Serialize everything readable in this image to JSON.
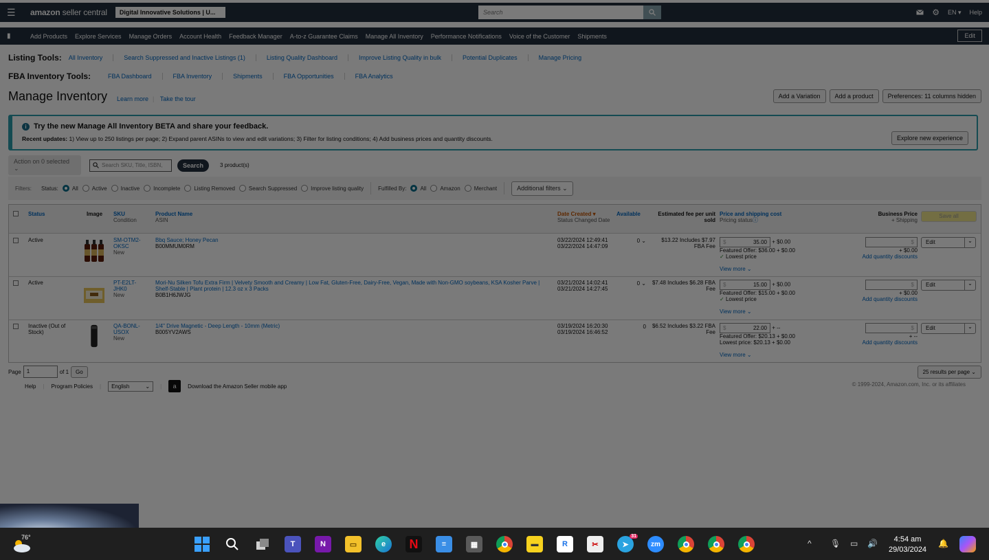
{
  "topbar": {
    "logo_bold": "amazon",
    "logo_rest": " seller central",
    "store": "Digital Innovative Solutions | U...",
    "search_placeholder": "Search",
    "lang": "EN ▾",
    "help": "Help"
  },
  "nav": {
    "items": [
      "Add Products",
      "Explore Services",
      "Manage Orders",
      "Account Health",
      "Feedback Manager",
      "A-to-z Guarantee Claims",
      "Manage All Inventory",
      "Performance Notifications",
      "Voice of the Customer",
      "Shipments"
    ],
    "edit": "Edit"
  },
  "listing_tools": {
    "title": "Listing Tools:",
    "links": [
      "All Inventory",
      "Search Suppressed and Inactive Listings (1)",
      "Listing Quality Dashboard",
      "Improve Listing Quality in bulk",
      "Potential Duplicates",
      "Manage Pricing"
    ]
  },
  "fba_tools": {
    "title": "FBA Inventory Tools:",
    "links": [
      "FBA Dashboard",
      "FBA Inventory",
      "Shipments",
      "FBA Opportunities",
      "FBA Analytics"
    ]
  },
  "page": {
    "title": "Manage Inventory",
    "learn_more": "Learn more",
    "take_tour": "Take the tour",
    "add_variation": "Add a Variation",
    "add_product": "Add a product",
    "preferences": "Preferences: 11 columns hidden"
  },
  "banner": {
    "title": "Try the new Manage All Inventory BETA and share your feedback.",
    "updates_label": "Recent updates:",
    "updates_text": " 1) View up to 250 listings per page; 2) Expand parent ASINs to view and edit variations; 3) Filter for listing conditions; 4) Add business prices and quantity discounts.",
    "button": "Explore new experience"
  },
  "actions": {
    "action_select": "Action on 0 selected",
    "search_placeholder": "Search SKU, Title, ISBN,",
    "search_button": "Search",
    "count": "3 product(s)"
  },
  "filters": {
    "label": "Filters:",
    "status_label": "Status:",
    "status_options": [
      "All",
      "Active",
      "Inactive",
      "Incomplete",
      "Listing Removed",
      "Search Suppressed",
      "Improve listing quality"
    ],
    "fulfilled_label": "Fulfilled By:",
    "fulfilled_options": [
      "All",
      "Amazon",
      "Merchant"
    ],
    "additional": "Additional filters"
  },
  "table": {
    "headers": {
      "status": "Status",
      "image": "Image",
      "sku": "SKU",
      "condition": "Condition",
      "product_name": "Product Name",
      "asin": "ASIN",
      "date_created": "Date Created ▾",
      "status_changed": "Status Changed Date",
      "available": "Available",
      "est_fee": "Estimated fee per unit sold",
      "price": "Price and shipping cost",
      "pricing_status": "Pricing status",
      "business_price": "Business Price",
      "plus_shipping": "+ Shipping",
      "save_all": "Save all"
    },
    "rows": [
      {
        "status": "Active",
        "sku": "SM-OTM2-OKSC",
        "condition": "New",
        "name": "Bbq Sauce; Honey Pecan",
        "asin": "B00MMUM0RM",
        "created": "03/22/2024 12:49:41",
        "changed": "03/22/2024 14:47:09",
        "available": "0",
        "fee": "$13.22 Includes $7.97 FBA Fee",
        "price": "35.00",
        "shipping": "+ $0.00",
        "featured": "Featured Offer: $36.00 + $0.00",
        "lowest_note": "Lowest price",
        "view_more": "View more",
        "bp_ship": "+ $0.00",
        "qty_discounts": "Add quantity discounts",
        "edit": "Edit"
      },
      {
        "status": "Active",
        "sku": "PT-E2LT-JHK0",
        "condition": "New",
        "name": "Mori-Nu Silken Tofu Extra Firm | Velvety Smooth and Creamy | Low Fat, Gluten-Free, Dairy-Free, Vegan, Made with Non-GMO soybeans, KSA Kosher Parve | Shelf-Stable | Plant protein | 12.3 oz x 3 Packs",
        "asin": "B0B1H6JWJG",
        "created": "03/21/2024 14:02:41",
        "changed": "03/21/2024 14:27:45",
        "available": "0",
        "fee": "$7.48 Includes $6.28 FBA Fee",
        "price": "15.00",
        "shipping": "+ $0.00",
        "featured": "Featured Offer: $15.00 + $0.00",
        "lowest_note": "Lowest price",
        "view_more": "View more",
        "bp_ship": "+ $0.00",
        "qty_discounts": "Add quantity discounts",
        "edit": "Edit"
      },
      {
        "status": "Inactive (Out of Stock)",
        "sku": "QA-BONL-USOX",
        "condition": "New",
        "name": "1/4\" Drive Magnetic - Deep Length - 10mm (Metric)",
        "asin": "B005YV2AWS",
        "created": "03/19/2024 16:20:30",
        "changed": "03/19/2024 16:46:52",
        "available": "0",
        "fee": "$6.52 Includes $3.22 FBA Fee",
        "price": "22.00",
        "shipping": "+ --",
        "featured": "Featured Offer: $20.13 + $0.00",
        "lowest_note": "Lowest price: $20.13 + $0.00",
        "view_more": "View more",
        "bp_ship": "+ --",
        "qty_discounts": "Add quantity discounts",
        "edit": "Edit"
      }
    ]
  },
  "pager": {
    "page_label": "Page",
    "page_value": "1",
    "of": "of 1",
    "go": "Go",
    "results": "25 results per page"
  },
  "footer": {
    "help": "Help",
    "policies": "Program Policies",
    "language": "English",
    "app": "Download the Amazon Seller mobile app",
    "copyright": "© 1999-2024, Amazon.com, Inc. or its affiliates"
  },
  "taskbar": {
    "temp": "76°",
    "time": "4:54 am",
    "date": "29/03/2024",
    "telegram_badge": "31"
  }
}
